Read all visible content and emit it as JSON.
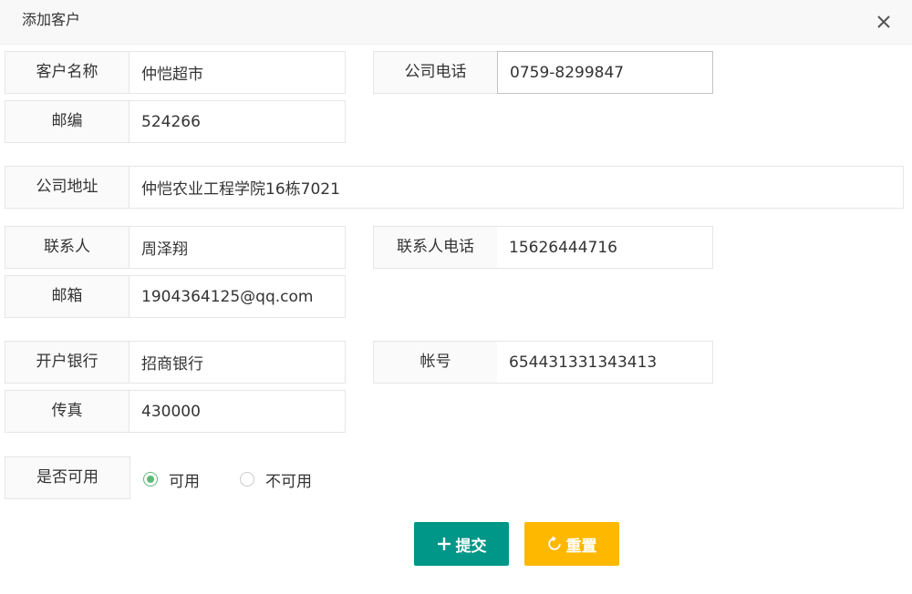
{
  "dialog": {
    "title": "添加客户",
    "close_icon": "close-icon"
  },
  "form": {
    "customer_name": {
      "label": "客户名称",
      "value": "仲恺超市"
    },
    "company_phone": {
      "label": "公司电话",
      "value": "0759-8299847"
    },
    "postcode": {
      "label": "邮编",
      "value": "524266"
    },
    "company_address": {
      "label": "公司地址",
      "value": "仲恺农业工程学院16栋7021"
    },
    "contact": {
      "label": "联系人",
      "value": "周泽翔"
    },
    "contact_phone": {
      "label": "联系人电话",
      "value": "15626444716"
    },
    "email": {
      "label": "邮箱",
      "value": "1904364125@qq.com"
    },
    "bank": {
      "label": "开户银行",
      "value": "招商银行"
    },
    "account": {
      "label": "帐号",
      "value": "654431331343413"
    },
    "fax": {
      "label": "传真",
      "value": "430000"
    },
    "available": {
      "label": "是否可用",
      "options": [
        "可用",
        "不可用"
      ],
      "selected": "可用"
    }
  },
  "actions": {
    "submit_label": "提交",
    "reset_label": "重置",
    "submit_icon": "plus-icon",
    "reset_icon": "refresh-icon"
  },
  "colors": {
    "submit": "#009688",
    "reset": "#ffb800",
    "radio_checked": "#5fb878"
  }
}
